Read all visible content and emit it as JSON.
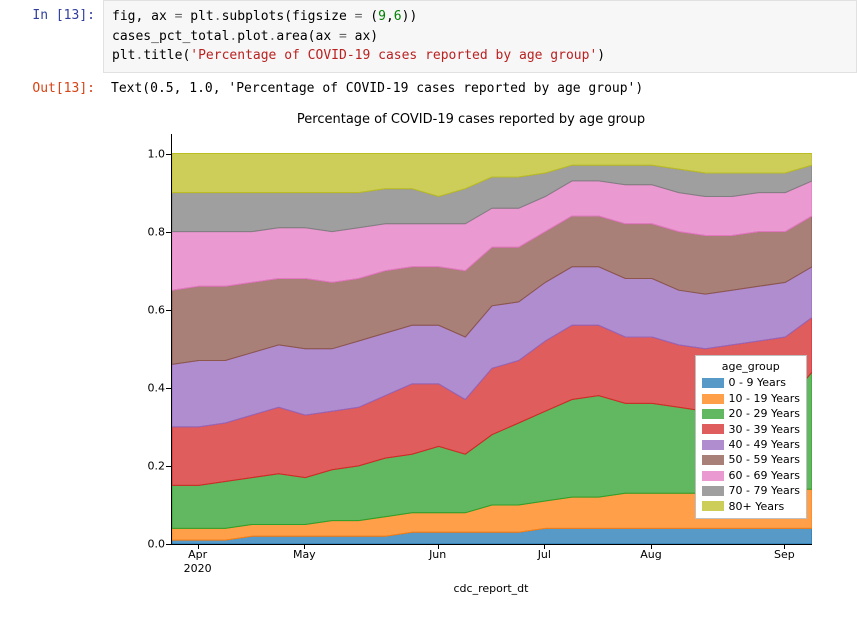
{
  "in_prompt": "In [13]:",
  "out_prompt": "Out[13]:",
  "code_tokens": [
    {
      "t": "fig",
      "c": "id"
    },
    {
      "t": ", ax ",
      "c": "id"
    },
    {
      "t": "=",
      "c": "op"
    },
    {
      "t": " plt",
      "c": "id"
    },
    {
      "t": ".",
      "c": "op"
    },
    {
      "t": "subplots(figsize ",
      "c": "id"
    },
    {
      "t": "=",
      "c": "op"
    },
    {
      "t": " (",
      "c": "id"
    },
    {
      "t": "9",
      "c": "num"
    },
    {
      "t": ",",
      "c": "id"
    },
    {
      "t": "6",
      "c": "num"
    },
    {
      "t": "))\n",
      "c": "id"
    },
    {
      "t": "cases_pct_total",
      "c": "id"
    },
    {
      "t": ".",
      "c": "op"
    },
    {
      "t": "plot",
      "c": "id"
    },
    {
      "t": ".",
      "c": "op"
    },
    {
      "t": "area(ax ",
      "c": "id"
    },
    {
      "t": "=",
      "c": "op"
    },
    {
      "t": " ax)\n",
      "c": "id"
    },
    {
      "t": "plt",
      "c": "id"
    },
    {
      "t": ".",
      "c": "op"
    },
    {
      "t": "title(",
      "c": "id"
    },
    {
      "t": "'Percentage of COVID-19 cases reported by age group'",
      "c": "str"
    },
    {
      "t": ")",
      "c": "id"
    }
  ],
  "output_text": "Text(0.5, 1.0, 'Percentage of COVID-19 cases reported by age group')",
  "chart_data": {
    "type": "area",
    "stacked": true,
    "title": "Percentage of COVID-19 cases reported by age group",
    "xlabel": "cdc_report_dt",
    "ylabel": "",
    "ylim": [
      0.0,
      1.05
    ],
    "yticks": [
      0.0,
      0.2,
      0.4,
      0.6,
      0.8,
      1.0
    ],
    "x_ticks_display": [
      "Apr\n2020",
      "May",
      "Jun",
      "Jul",
      "Aug",
      "Sep"
    ],
    "x_ticks_idx": [
      1,
      5,
      10,
      14,
      18,
      23
    ],
    "x": [
      "2020-03-22",
      "2020-03-29",
      "2020-04-05",
      "2020-04-12",
      "2020-04-19",
      "2020-04-26",
      "2020-05-03",
      "2020-05-10",
      "2020-05-17",
      "2020-05-24",
      "2020-05-31",
      "2020-06-07",
      "2020-06-14",
      "2020-06-21",
      "2020-06-28",
      "2020-07-05",
      "2020-07-12",
      "2020-07-19",
      "2020-07-26",
      "2020-08-02",
      "2020-08-09",
      "2020-08-16",
      "2020-08-23",
      "2020-08-30",
      "2020-09-06"
    ],
    "legend_title": "age_group",
    "series": [
      {
        "name": "0 - 9 Years",
        "color": "#1f77b4",
        "values": [
          0.01,
          0.01,
          0.01,
          0.02,
          0.02,
          0.02,
          0.02,
          0.02,
          0.02,
          0.03,
          0.03,
          0.03,
          0.03,
          0.03,
          0.04,
          0.04,
          0.04,
          0.04,
          0.04,
          0.04,
          0.04,
          0.04,
          0.04,
          0.04,
          0.04
        ]
      },
      {
        "name": "10 - 19 Years",
        "color": "#ff7f0e",
        "values": [
          0.03,
          0.03,
          0.03,
          0.03,
          0.03,
          0.03,
          0.04,
          0.04,
          0.05,
          0.05,
          0.05,
          0.05,
          0.07,
          0.07,
          0.07,
          0.08,
          0.08,
          0.09,
          0.09,
          0.09,
          0.09,
          0.09,
          0.1,
          0.1,
          0.1
        ]
      },
      {
        "name": "20 - 29 Years",
        "color": "#2ca02c",
        "values": [
          0.11,
          0.11,
          0.12,
          0.12,
          0.13,
          0.12,
          0.13,
          0.14,
          0.15,
          0.15,
          0.17,
          0.15,
          0.18,
          0.21,
          0.23,
          0.25,
          0.26,
          0.23,
          0.23,
          0.22,
          0.21,
          0.22,
          0.22,
          0.22,
          0.3
        ]
      },
      {
        "name": "30 - 39 Years",
        "color": "#d62728",
        "values": [
          0.15,
          0.15,
          0.15,
          0.16,
          0.17,
          0.16,
          0.15,
          0.15,
          0.16,
          0.18,
          0.16,
          0.14,
          0.17,
          0.16,
          0.18,
          0.19,
          0.18,
          0.17,
          0.17,
          0.16,
          0.16,
          0.16,
          0.16,
          0.17,
          0.14
        ]
      },
      {
        "name": "40 - 49 Years",
        "color": "#9467bd",
        "values": [
          0.16,
          0.17,
          0.16,
          0.16,
          0.16,
          0.17,
          0.16,
          0.17,
          0.16,
          0.15,
          0.15,
          0.16,
          0.16,
          0.15,
          0.15,
          0.15,
          0.15,
          0.15,
          0.15,
          0.14,
          0.14,
          0.14,
          0.14,
          0.14,
          0.13
        ]
      },
      {
        "name": "50 - 59 Years",
        "color": "#8c564b",
        "values": [
          0.19,
          0.19,
          0.19,
          0.18,
          0.17,
          0.18,
          0.17,
          0.16,
          0.16,
          0.15,
          0.15,
          0.17,
          0.15,
          0.14,
          0.13,
          0.13,
          0.13,
          0.14,
          0.14,
          0.15,
          0.15,
          0.14,
          0.14,
          0.13,
          0.13
        ]
      },
      {
        "name": "60 - 69 Years",
        "color": "#e377c2",
        "values": [
          0.15,
          0.14,
          0.14,
          0.13,
          0.13,
          0.13,
          0.13,
          0.13,
          0.12,
          0.11,
          0.11,
          0.12,
          0.1,
          0.1,
          0.09,
          0.09,
          0.09,
          0.1,
          0.1,
          0.1,
          0.1,
          0.1,
          0.1,
          0.1,
          0.09
        ]
      },
      {
        "name": "70 - 79 Years",
        "color": "#7f7f7f",
        "values": [
          0.1,
          0.1,
          0.1,
          0.1,
          0.09,
          0.09,
          0.1,
          0.09,
          0.09,
          0.09,
          0.07,
          0.09,
          0.08,
          0.08,
          0.06,
          0.04,
          0.04,
          0.05,
          0.05,
          0.06,
          0.06,
          0.06,
          0.05,
          0.05,
          0.04
        ]
      },
      {
        "name": "80+ Years",
        "color": "#bcbd22",
        "values": [
          0.1,
          0.1,
          0.1,
          0.1,
          0.1,
          0.1,
          0.1,
          0.1,
          0.09,
          0.09,
          0.11,
          0.09,
          0.06,
          0.06,
          0.05,
          0.03,
          0.03,
          0.03,
          0.03,
          0.04,
          0.05,
          0.05,
          0.05,
          0.05,
          0.03
        ]
      }
    ]
  }
}
